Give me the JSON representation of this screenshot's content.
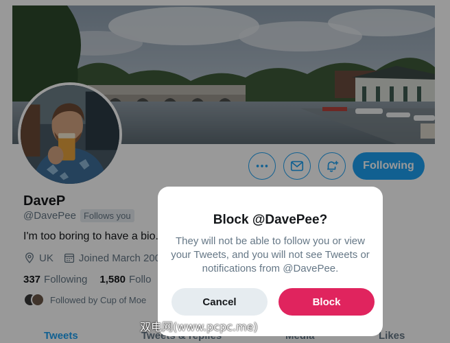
{
  "profile": {
    "display_name": "DaveP",
    "handle": "@DavePee",
    "follows_you": "Follows you",
    "bio": "I'm too boring to have a bio.",
    "location": "UK",
    "joined": "Joined March 200",
    "following_count": "337",
    "following_label": "Following",
    "followers_count": "1,580",
    "followers_label": "Follo",
    "followed_by": "Followed by Cup of Moe"
  },
  "actions": {
    "more_icon": "more-icon",
    "message_icon": "mail-icon",
    "notify_icon": "bell-plus-icon",
    "following_label": "Following"
  },
  "tabs": [
    {
      "label": "Tweets",
      "active": true
    },
    {
      "label": "Tweets & replies",
      "active": false
    },
    {
      "label": "Media",
      "active": false
    },
    {
      "label": "Likes",
      "active": false
    }
  ],
  "dialog": {
    "title": "Block @DavePee?",
    "body": "They will not be able to follow you or view your Tweets, and you will not see Tweets or notifications from @DavePee.",
    "cancel_label": "Cancel",
    "block_label": "Block"
  },
  "watermark": "双电网(www.pcpc.me)",
  "colors": {
    "accent": "#1da1f2",
    "danger": "#e0245e",
    "secondary_text": "#657786",
    "overlay": "rgba(0,0,0,0.40)"
  }
}
